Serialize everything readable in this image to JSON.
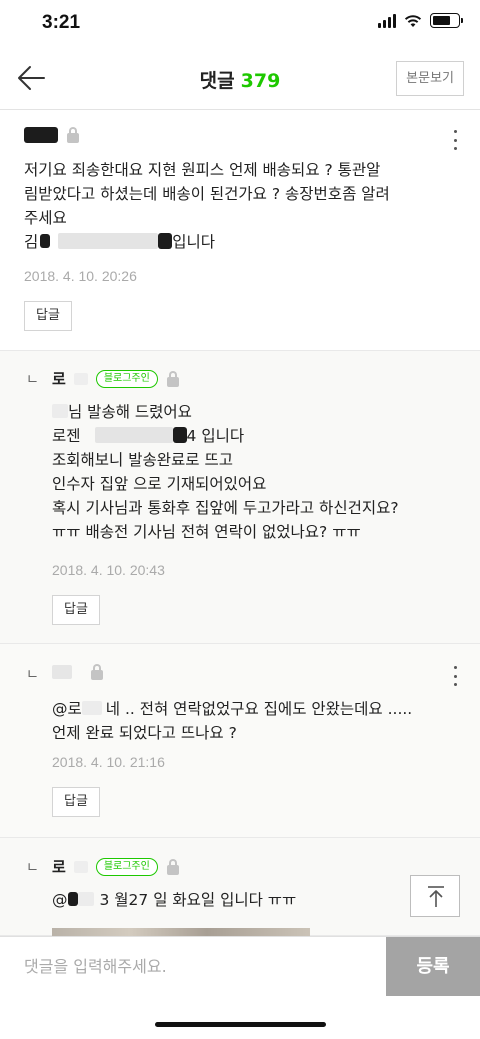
{
  "status_bar": {
    "time": "3:21",
    "battery_level": 0.7
  },
  "header": {
    "title": "댓글",
    "count": "379",
    "original_post_button": "본문보기"
  },
  "comments": [
    {
      "type": "comment",
      "lines": [
        "저기요 죄송한대요  지현 원피스 언제 배송되요 ? 통관알",
        "림받았다고 하셨는데 배송이 된건가요 ? 송장번호좀 알려",
        "주세요"
      ],
      "line4_start": "김",
      "line4_end": "입니다",
      "date": "2018. 4. 10. 20:26",
      "reply_label": "답글"
    },
    {
      "type": "reply",
      "author": "로",
      "badge": "블로그주인",
      "line1_end": "님 발송해 드렸어요",
      "line2_start": "로젠",
      "line2_end": "4 입니다",
      "lines": [
        "조회해보니  발송완료로 뜨고",
        "인수자 집앞 으로 기재되어있어요",
        "혹시 기사님과 통화후 집앞에 두고가라고 하신건지요?",
        "ㅠㅠ 배송전 기사님 전혀 연락이 없었나요? ㅠㅠ"
      ],
      "date": "2018. 4. 10. 20:43",
      "reply_label": "답글"
    },
    {
      "type": "reply",
      "line1_start": "@로",
      "line1_end": "네 .. 전혀 연락없었구요 집에도 안왔는데요 .....",
      "lines": [
        "언제 완료 되었다고 뜨나요 ?"
      ],
      "date": "2018. 4. 10. 21:16",
      "reply_label": "답글"
    },
    {
      "type": "reply",
      "author": "로",
      "badge": "블로그주인",
      "line1_start": "@",
      "line1_end": "3 월27 일 화요일 입니다 ㅠㅠ"
    }
  ],
  "reply_mark": "ㄴ",
  "input": {
    "placeholder": "댓글을 입력해주세요.",
    "submit_label": "등록"
  },
  "icons": [
    "back-arrow-icon",
    "lock-icon",
    "more-vertical-icon",
    "scroll-to-top-icon",
    "wifi-icon",
    "signal-icon",
    "battery-icon"
  ],
  "colors": {
    "accent": "#1ec800",
    "submit_bg": "#a4a4a4",
    "muted_text": "#aaaaaa"
  }
}
